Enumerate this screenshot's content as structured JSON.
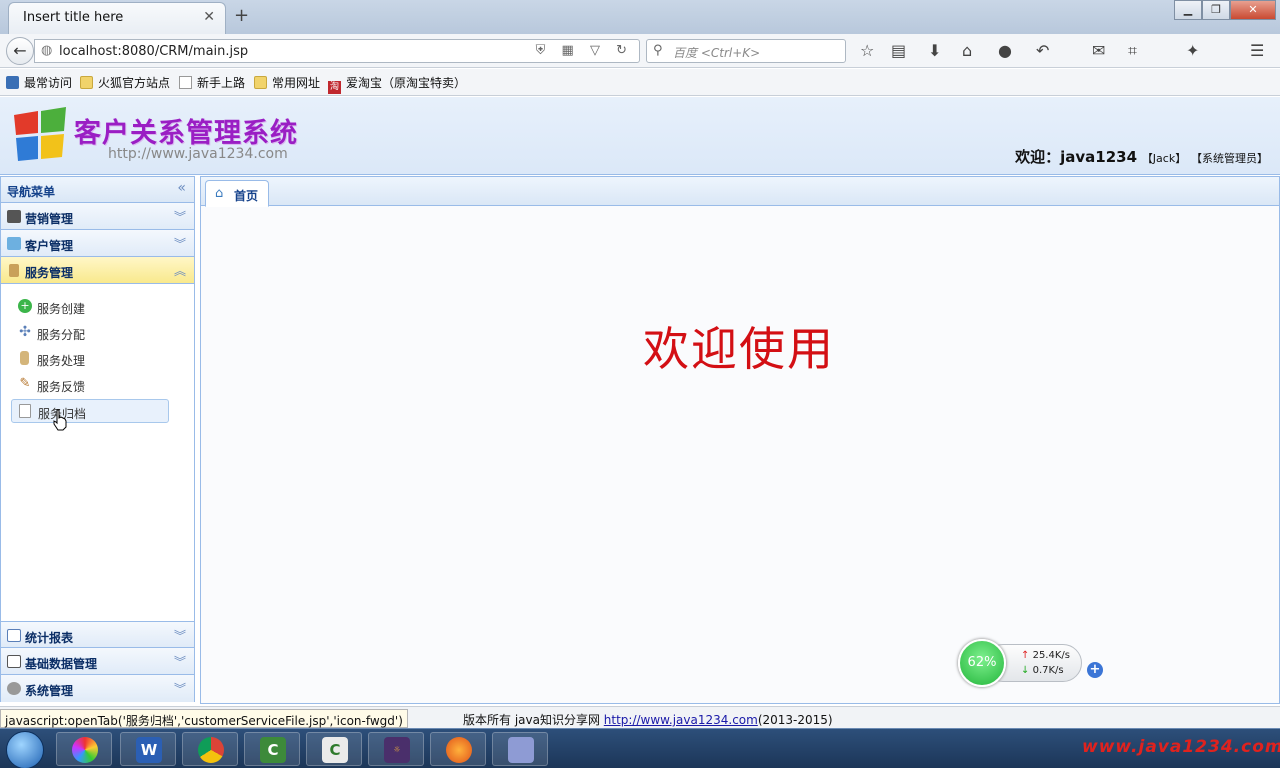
{
  "browser": {
    "tab_title": "Insert title here",
    "url": "localhost:8080/CRM/main.jsp",
    "search_placeholder": "百度 <Ctrl+K>",
    "bookmarks": [
      "最常访问",
      "火狐官方站点",
      "新手上路",
      "常用网址",
      "爱淘宝（原淘宝特卖）"
    ]
  },
  "header": {
    "title": "客户关系管理系统",
    "site_url": "http://www.java1234.com",
    "welcome_prefix": "欢迎：java1234",
    "user": "【Jack】",
    "role": "【系统管理员】"
  },
  "sidebar": {
    "title": "导航菜单",
    "sections": [
      {
        "label": "营销管理",
        "icon": "marketing-icon"
      },
      {
        "label": "客户管理",
        "icon": "customer-icon"
      },
      {
        "label": "服务管理",
        "icon": "service-icon",
        "expanded": true
      },
      {
        "label": "统计报表",
        "icon": "report-icon"
      },
      {
        "label": "基础数据管理",
        "icon": "basic-data-icon"
      },
      {
        "label": "系统管理",
        "icon": "system-gear-icon"
      }
    ],
    "service_items": [
      {
        "label": "服务创建",
        "icon": "service-create-icon"
      },
      {
        "label": "服务分配",
        "icon": "service-assign-icon"
      },
      {
        "label": "服务处理",
        "icon": "service-process-icon"
      },
      {
        "label": "服务反馈",
        "icon": "service-feedback-icon"
      },
      {
        "label": "服务归档",
        "icon": "service-archive-icon"
      }
    ]
  },
  "main": {
    "home_tab": "首页",
    "welcome_text": "欢迎使用"
  },
  "widget": {
    "percent": "62%",
    "upload": "25.4K/s",
    "download": "0.7K/s"
  },
  "status": {
    "link_preview": "javascript:openTab('服务归档','customerServiceFile.jsp','icon-fwgd')",
    "copyright_prefix": "版本所有 java知识分享网 ",
    "copyright_link": "http://www.java1234.com",
    "copyright_suffix": "(2013-2015)"
  },
  "taskbar": {
    "watermark": "www.java1234.com"
  },
  "colors": {
    "accent_border": "#99bbe8",
    "title_purple": "#9a1ec4",
    "welcome_red": "#d30f14",
    "active_section": "#f9e98d"
  }
}
